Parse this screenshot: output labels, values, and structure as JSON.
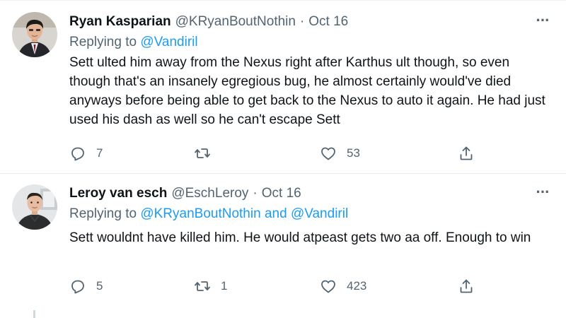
{
  "tweets": [
    {
      "display_name": "Ryan Kasparian",
      "handle": "@KRyanBoutNothin",
      "separator": "·",
      "date": "Oct 16",
      "more_icon": "more-horizontal-icon",
      "more_label": "···",
      "reply_prefix": "Replying to",
      "reply_to": "@Vandiril",
      "text": "Sett ulted him away from the Nexus right after Karthus ult though, so even though that's an insanely egregious bug, he almost certainly would've died anyways before being able to get back to the Nexus to auto it again. He had just used his dash as well so he can't escape Sett",
      "actions": {
        "reply_icon": "reply-icon",
        "reply_count": "7",
        "retweet_icon": "retweet-icon",
        "retweet_count": "",
        "like_icon": "heart-icon",
        "like_count": "53",
        "share_icon": "share-icon"
      }
    },
    {
      "display_name": "Leroy van esch",
      "handle": "@EschLeroy",
      "separator": "·",
      "date": "Oct 16",
      "more_icon": "more-horizontal-icon",
      "more_label": "···",
      "reply_prefix": "Replying to",
      "reply_to_1": "@KRyanBoutNothin",
      "reply_and": "and",
      "reply_to_2": "@Vandiril",
      "text": "Sett wouldnt have killed him. He would atpeast gets two aa off. Enough to win",
      "actions": {
        "reply_icon": "reply-icon",
        "reply_count": "5",
        "retweet_icon": "retweet-icon",
        "retweet_count": "1",
        "like_icon": "heart-icon",
        "like_count": "423",
        "share_icon": "share-icon"
      }
    }
  ],
  "colors": {
    "text_primary": "#0f1419",
    "text_secondary": "#536471",
    "link": "#1d9bf0",
    "divider": "#e6ecf0"
  }
}
